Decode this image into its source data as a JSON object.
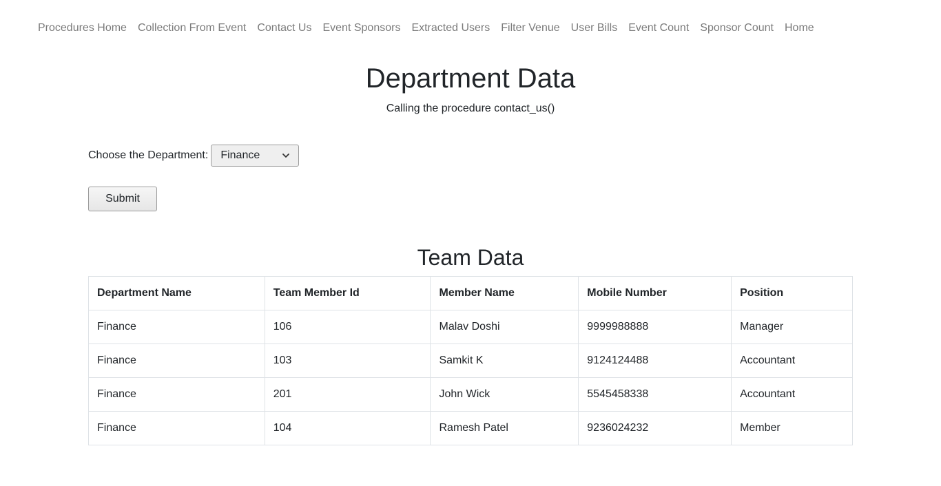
{
  "nav": {
    "items": [
      {
        "label": "Procedures Home"
      },
      {
        "label": "Collection From Event"
      },
      {
        "label": "Contact Us"
      },
      {
        "label": "Event Sponsors"
      },
      {
        "label": "Extracted Users"
      },
      {
        "label": "Filter Venue"
      },
      {
        "label": "User Bills"
      },
      {
        "label": "Event Count"
      },
      {
        "label": "Sponsor Count"
      },
      {
        "label": "Home"
      }
    ]
  },
  "header": {
    "title": "Department Data",
    "subtitle": "Calling the procedure contact_us()"
  },
  "form": {
    "label": "Choose the Department:",
    "select_value": "Finance",
    "select_icon": "chevron-down-icon",
    "submit_label": "Submit"
  },
  "team": {
    "title": "Team Data",
    "columns": [
      "Department Name",
      "Team Member Id",
      "Member Name",
      "Mobile Number",
      "Position"
    ],
    "rows": [
      [
        "Finance",
        "106",
        "Malav Doshi",
        "9999988888",
        "Manager"
      ],
      [
        "Finance",
        "103",
        "Samkit K",
        "9124124488",
        "Accountant"
      ],
      [
        "Finance",
        "201",
        "John Wick",
        "5545458338",
        "Accountant"
      ],
      [
        "Finance",
        "104",
        "Ramesh Patel",
        "9236024232",
        "Member"
      ]
    ]
  }
}
